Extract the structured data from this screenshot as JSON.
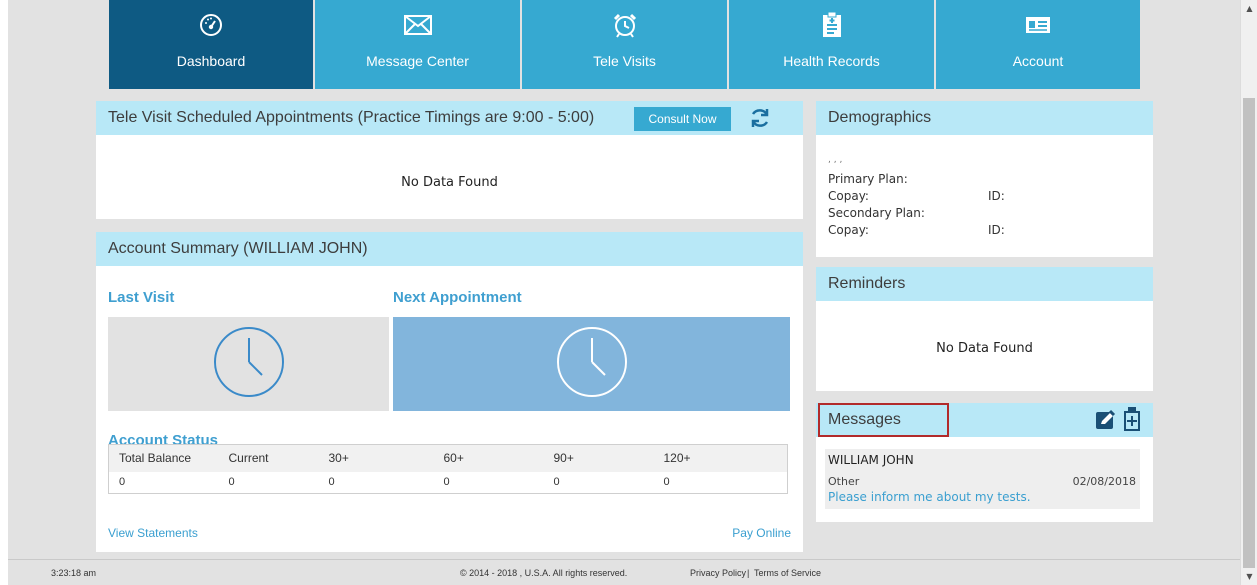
{
  "nav": {
    "items": [
      {
        "label": "Dashboard",
        "icon": "dashboard-gauge-icon",
        "active": true
      },
      {
        "label": "Message Center",
        "icon": "envelope-icon",
        "active": false
      },
      {
        "label": "Tele Visits",
        "icon": "alarm-clock-icon",
        "active": false
      },
      {
        "label": "Health Records",
        "icon": "clipboard-icon",
        "active": false
      },
      {
        "label": "Account",
        "icon": "id-card-icon",
        "active": false
      }
    ]
  },
  "tele": {
    "title": "Tele Visit Scheduled Appointments (Practice Timings are 9:00 - 5:00)",
    "consult_label": "Consult Now",
    "empty": "No Data Found"
  },
  "account": {
    "title": "Account Summary (WILLIAM JOHN)",
    "last_visit": "Last Visit",
    "next_appointment": "Next Appointment",
    "status_title": "Account Status",
    "columns": [
      "Total Balance",
      "Current",
      "30+",
      "60+",
      "90+",
      "120+"
    ],
    "values": [
      "0",
      "0",
      "0",
      "0",
      "0",
      "0"
    ],
    "view_statements": "View Statements",
    "pay_online": "Pay Online"
  },
  "demographics": {
    "title": "Demographics",
    "name_line": ", , ,",
    "primary_plan": "Primary Plan:",
    "copay1": "Copay:",
    "id1": "ID:",
    "secondary_plan": "Secondary Plan:",
    "copay2": "Copay:",
    "id2": "ID:"
  },
  "reminders": {
    "title": "Reminders",
    "empty": "No Data Found"
  },
  "messages": {
    "title": "Messages",
    "item": {
      "sender": "WILLIAM JOHN",
      "category": "Other",
      "date": "02/08/2018",
      "subject": "Please inform me about my tests."
    }
  },
  "footer": {
    "time": "3:23:18 am",
    "copyright": "© 2014 - 2018 , U.S.A. All rights reserved.",
    "privacy": "Privacy Policy",
    "separator": "|",
    "terms": "Terms of Service"
  },
  "colors": {
    "nav_active": "#0e5a83",
    "nav": "#36a9d1",
    "panel_header": "#b8e8f7",
    "link": "#3a9fd0",
    "highlight_border": "#b22a2a"
  }
}
